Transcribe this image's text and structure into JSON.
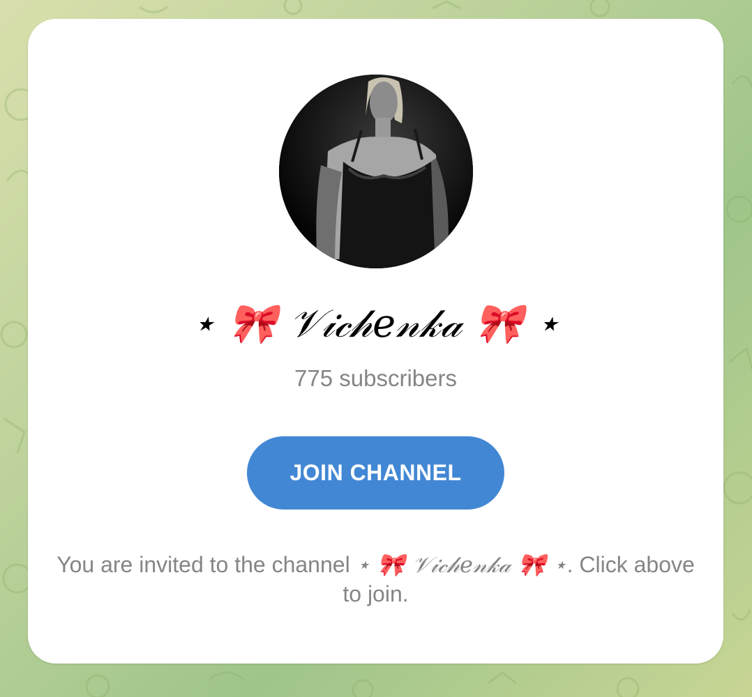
{
  "channel": {
    "name": "⋆ 🎀 𝒱𝒾𝒸𝒽𝑒𝓃𝓀𝒶 🎀 ⋆",
    "subscribers": "775 subscribers"
  },
  "actions": {
    "join_label": "JOIN CHANNEL"
  },
  "invite": {
    "prefix": "You are invited to the channel ",
    "channel_name": "⋆ 🎀 𝒱𝒾𝒸𝒽𝑒𝓃𝓀𝒶 🎀 ⋆",
    "suffix": ". Click above to join."
  },
  "colors": {
    "accent": "#4287d4",
    "secondary_text": "#858585",
    "card_background": "#ffffff"
  },
  "icons": {
    "avatar": "channel-avatar-photo",
    "background": "doodle-pattern"
  }
}
